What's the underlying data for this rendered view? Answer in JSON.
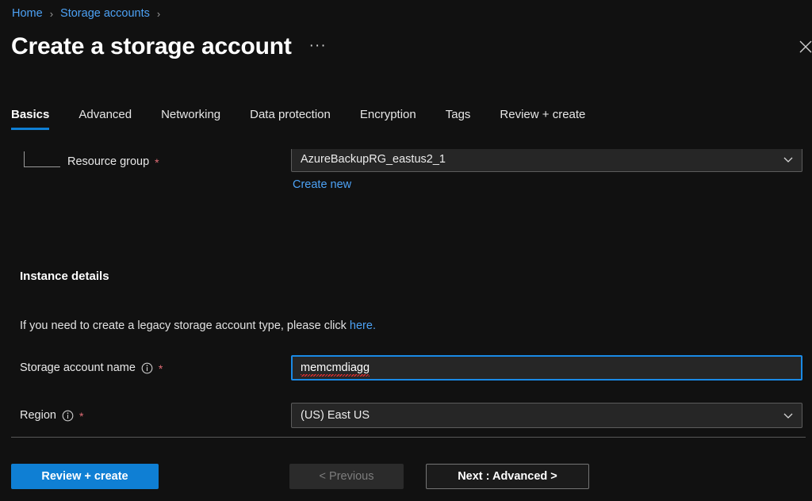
{
  "breadcrumb": {
    "items": [
      {
        "label": "Home",
        "sep": "›"
      },
      {
        "label": "Storage accounts",
        "sep": "›"
      }
    ]
  },
  "header": {
    "title": "Create a storage account",
    "more_label": "···",
    "close_icon": "close-icon"
  },
  "tabs": [
    {
      "label": "Basics",
      "active": true
    },
    {
      "label": "Advanced",
      "active": false
    },
    {
      "label": "Networking",
      "active": false
    },
    {
      "label": "Data protection",
      "active": false
    },
    {
      "label": "Encryption",
      "active": false
    },
    {
      "label": "Tags",
      "active": false
    },
    {
      "label": "Review + create",
      "active": false
    }
  ],
  "form": {
    "resource_group": {
      "label": "Resource group",
      "required_mark": "*",
      "value": "AzureBackupRG_eastus2_1",
      "create_new_label": "Create new",
      "chevron_icon": "chevron-down-icon"
    },
    "instance_details": {
      "heading": "Instance details",
      "legacy_note_prefix": "If you need to create a legacy storage account type, please click ",
      "legacy_note_link": "here."
    },
    "storage_account_name": {
      "label": "Storage account name",
      "required_mark": "*",
      "info_icon": "info-icon",
      "value": "memcmdiagg",
      "placeholder": ""
    },
    "region": {
      "label": "Region",
      "required_mark": "*",
      "info_icon": "info-icon",
      "value": "(US) East US",
      "chevron_icon": "chevron-down-icon"
    }
  },
  "actions": {
    "review_create": "Review + create",
    "previous": "< Previous",
    "next": "Next : Advanced >"
  },
  "colors": {
    "background": "#111111",
    "accent_blue": "#0f7fd4",
    "link_blue": "#4da2f5",
    "required_red": "#e06c75",
    "input_fill": "#262626",
    "input_border": "#5c5c5c",
    "focus_border": "#1a8ae5"
  }
}
